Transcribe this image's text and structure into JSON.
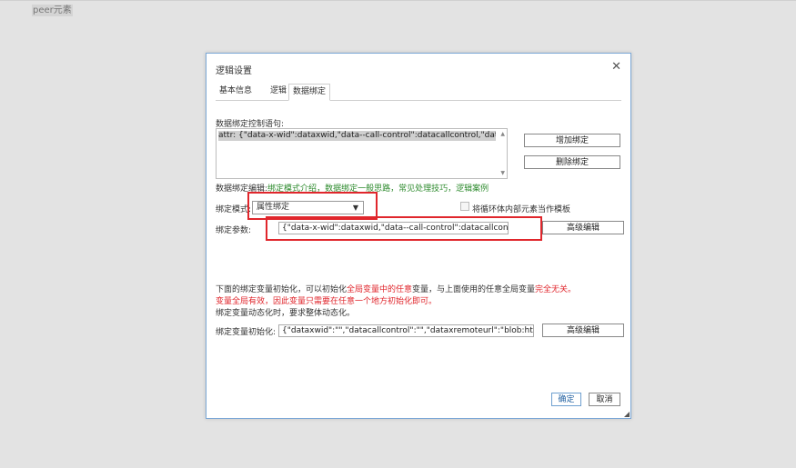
{
  "top_label": "peer元素",
  "dialog": {
    "title": "逻辑设置",
    "tabs": [
      "基本信息",
      "逻辑",
      "数据绑定"
    ],
    "active_tab": "数据绑定",
    "binding_control_label": "数据绑定控制语句:",
    "binding_control_value": "attr: {\"data-x-wid\":dataxwid,\"data--call-control\":datacallcontrol,\"data--call-wid\"",
    "add_binding": "增加绑定",
    "delete_binding": "删除绑定",
    "edit_prefix": "数据绑定编辑:",
    "edit_links": [
      "绑定模式介绍",
      "数据绑定一般思路",
      "常见处理技巧",
      "逻辑案例"
    ],
    "mode_label": "绑定模式:",
    "mode_value": "属性绑定",
    "loop_template_label": "将循环体内部元素当作模板",
    "param_label": "绑定参数:",
    "param_value": "{\"data-x-wid\":dataxwid,\"data--call-control\":datacallcontrol,\"data--call-w",
    "advanced_edit": "高级编辑",
    "desc1_a": "下面的绑定变量初始化，可以初始化",
    "desc1_b": "全局变量中的任意",
    "desc1_c": "变量，与上面使用的任意全局变量",
    "desc1_d": "完全无关。",
    "desc2": "变量全局有效，因此变量只需要在任意一个地方初始化即可。",
    "desc3": "绑定变量动态化时，要求整体动态化。",
    "init_label": "绑定变量初始化:",
    "init_value": "{\"dataxwid\":\"\",\"datacallcontrol\":\"\",\"dataxremoteurl\":\"blob:https://www.t",
    "advanced_edit_2": "高级编辑",
    "confirm": "确定",
    "cancel": "取消"
  },
  "colors": {
    "highlight": "#e0262c",
    "link_green": "#2e8b2e",
    "warning_red": "#e0262c"
  }
}
